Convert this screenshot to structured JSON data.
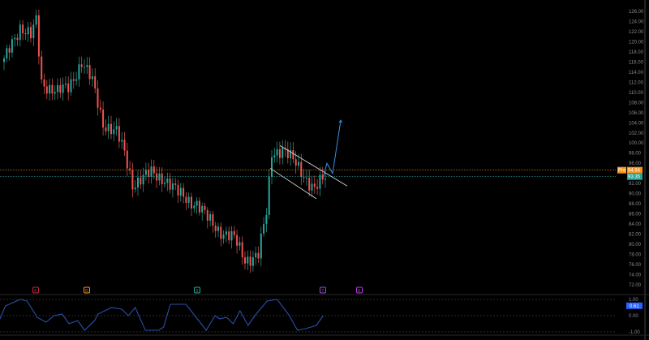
{
  "chart_data": {
    "type": "candlestick",
    "y_ticks": [
      126,
      124,
      122,
      120,
      118,
      116,
      114,
      112,
      110,
      108,
      106,
      104,
      102,
      100,
      98,
      96,
      92,
      90,
      88,
      86,
      84,
      82,
      80,
      78,
      76,
      74,
      72
    ],
    "ylim": [
      71,
      128
    ],
    "close_keyframes": [
      [
        0,
        116
      ],
      [
        3,
        120
      ],
      [
        6,
        123
      ],
      [
        10,
        121
      ],
      [
        12,
        124
      ],
      [
        14,
        112
      ],
      [
        20,
        110
      ],
      [
        24,
        111
      ],
      [
        29,
        116
      ],
      [
        33,
        112
      ],
      [
        37,
        104
      ],
      [
        42,
        102
      ],
      [
        45,
        98
      ],
      [
        48,
        92
      ],
      [
        55,
        94
      ],
      [
        60,
        93
      ],
      [
        65,
        90
      ],
      [
        72,
        88
      ],
      [
        76,
        85
      ],
      [
        80,
        83
      ],
      [
        86,
        81
      ],
      [
        90,
        77
      ],
      [
        95,
        78
      ],
      [
        98,
        86
      ],
      [
        100,
        98
      ],
      [
        104,
        99
      ],
      [
        110,
        95
      ],
      [
        116,
        91
      ],
      [
        120,
        93
      ]
    ],
    "price_lines": [
      {
        "label": "Pre",
        "value": "94.64",
        "price": 94.64,
        "color": "#f7931a"
      },
      {
        "label": "",
        "value": "93.35",
        "price": 93.35,
        "color": "#26a69a"
      }
    ],
    "channel": {
      "upper": [
        [
          345,
          99.5
        ],
        [
          428,
          91.5
        ]
      ],
      "lower": [
        [
          333,
          95
        ],
        [
          390,
          89
        ]
      ]
    },
    "projection": [
      [
        398,
        93
      ],
      [
        403,
        96
      ],
      [
        410,
        94
      ],
      [
        420,
        104.5
      ]
    ],
    "events": [
      {
        "letter": "E",
        "color": "#c2283f"
      },
      {
        "letter": "D",
        "color": "#f7931a"
      },
      {
        "letter": "S",
        "color": "#26a69a"
      },
      {
        "letter": "?",
        "color": "#9c4dcc"
      },
      {
        "letter": "E",
        "color": "#b23cd6"
      }
    ],
    "oscillator": {
      "ticks": [
        "1.00",
        "0.00",
        "-1.00"
      ],
      "current": "0.61",
      "keyframes": [
        [
          0,
          -0.2
        ],
        [
          8,
          0.6
        ],
        [
          30,
          1.0
        ],
        [
          40,
          0.9
        ],
        [
          55,
          -0.1
        ],
        [
          68,
          -0.4
        ],
        [
          80,
          0.0
        ],
        [
          92,
          0.1
        ],
        [
          102,
          -0.5
        ],
        [
          115,
          -0.3
        ],
        [
          125,
          -0.9
        ],
        [
          140,
          -0.3
        ],
        [
          145,
          0.1
        ],
        [
          165,
          0.5
        ],
        [
          180,
          0.4
        ],
        [
          190,
          0.0
        ],
        [
          200,
          0.5
        ],
        [
          215,
          -0.9
        ],
        [
          235,
          -0.9
        ],
        [
          242,
          -0.7
        ],
        [
          252,
          0.7
        ],
        [
          275,
          0.7
        ],
        [
          290,
          -0.1
        ],
        [
          305,
          -0.9
        ],
        [
          318,
          0.0
        ],
        [
          325,
          -0.2
        ],
        [
          335,
          -0.1
        ],
        [
          345,
          -0.5
        ],
        [
          355,
          0.3
        ],
        [
          367,
          -0.6
        ],
        [
          377,
          0.0
        ],
        [
          385,
          0.4
        ],
        [
          395,
          0.9
        ],
        [
          410,
          1.0
        ],
        [
          428,
          0.0
        ],
        [
          440,
          -0.9
        ],
        [
          452,
          -0.8
        ],
        [
          468,
          -0.6
        ],
        [
          478,
          0.0
        ],
        [
          398,
          0.61
        ]
      ]
    }
  }
}
